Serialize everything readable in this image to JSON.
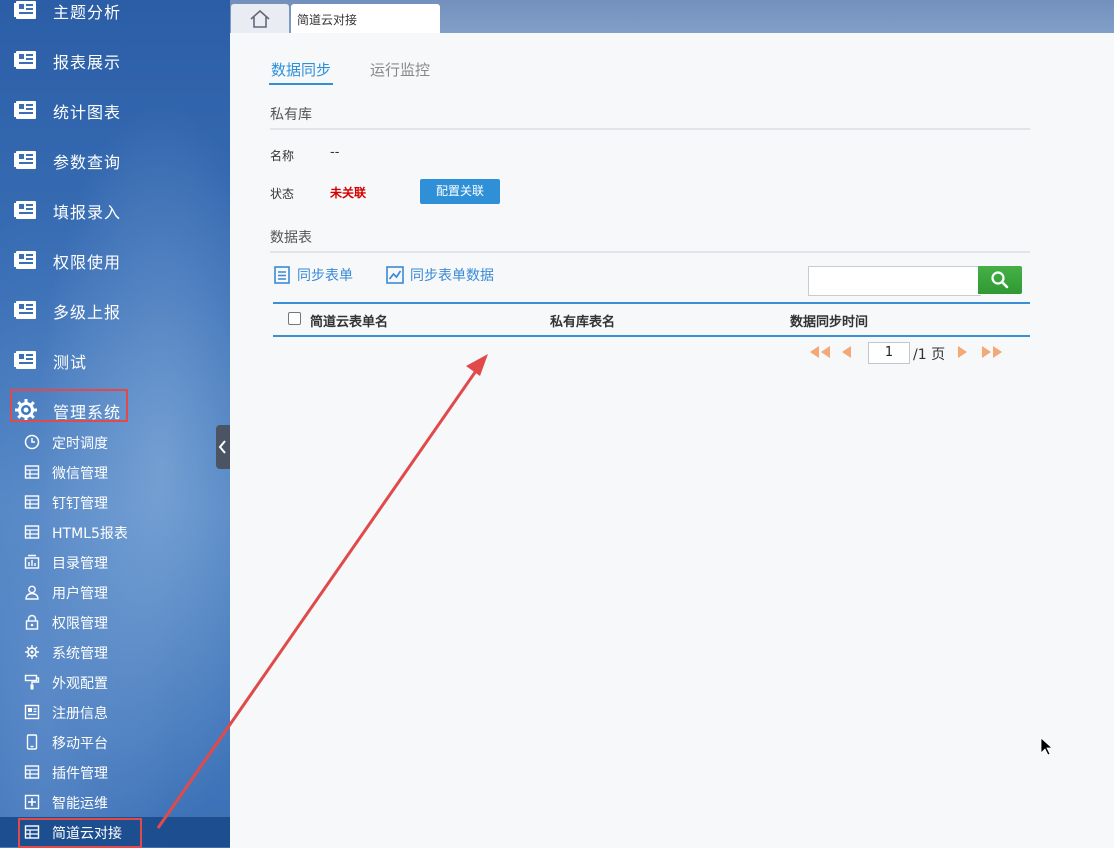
{
  "sidebar": {
    "top_items": [
      {
        "label": "主题分析",
        "icon": "report-icon"
      },
      {
        "label": "报表展示",
        "icon": "report-icon"
      },
      {
        "label": "统计图表",
        "icon": "report-icon"
      },
      {
        "label": "参数查询",
        "icon": "report-icon"
      },
      {
        "label": "填报录入",
        "icon": "report-icon"
      },
      {
        "label": "权限使用",
        "icon": "report-icon"
      },
      {
        "label": "多级上报",
        "icon": "report-icon"
      },
      {
        "label": "测试",
        "icon": "report-icon"
      },
      {
        "label": "管理系统",
        "icon": "gear-icon"
      }
    ],
    "sub_items": [
      {
        "label": "定时调度",
        "icon": "clock-icon"
      },
      {
        "label": "微信管理",
        "icon": "grid-icon"
      },
      {
        "label": "钉钉管理",
        "icon": "grid-icon"
      },
      {
        "label": "HTML5报表",
        "icon": "grid-icon"
      },
      {
        "label": "目录管理",
        "icon": "folder-chart-icon"
      },
      {
        "label": "用户管理",
        "icon": "user-icon"
      },
      {
        "label": "权限管理",
        "icon": "lock-icon"
      },
      {
        "label": "系统管理",
        "icon": "gear-small-icon"
      },
      {
        "label": "外观配置",
        "icon": "paint-roller-icon"
      },
      {
        "label": "注册信息",
        "icon": "document-icon"
      },
      {
        "label": "移动平台",
        "icon": "mobile-icon"
      },
      {
        "label": "插件管理",
        "icon": "grid-icon"
      },
      {
        "label": "智能运维",
        "icon": "plus-box-icon"
      },
      {
        "label": "简道云对接",
        "icon": "grid-icon"
      }
    ]
  },
  "tabs": {
    "home_icon": "home-icon",
    "active_label": "简道云对接"
  },
  "main": {
    "subtabs": [
      {
        "label": "数据同步",
        "active": true
      },
      {
        "label": "运行监控",
        "active": false
      }
    ],
    "private_db": {
      "section_title": "私有库",
      "name_label": "名称",
      "name_value": "--",
      "status_label": "状态",
      "status_value": "未关联",
      "config_button": "配置关联"
    },
    "data_tables": {
      "section_title": "数据表",
      "sync_form_label": "同步表单",
      "sync_form_data_label": "同步表单数据",
      "search_placeholder": "",
      "columns": [
        "简道云表单名",
        "私有库表名",
        "数据同步时间"
      ],
      "rows": [],
      "pager": {
        "current_page": "1",
        "total_text": "/1 页"
      }
    }
  },
  "colors": {
    "accent": "#2f90d8",
    "status_red": "#d40000",
    "search_green": "#39a33d",
    "annotation_red": "#e04a4a"
  }
}
